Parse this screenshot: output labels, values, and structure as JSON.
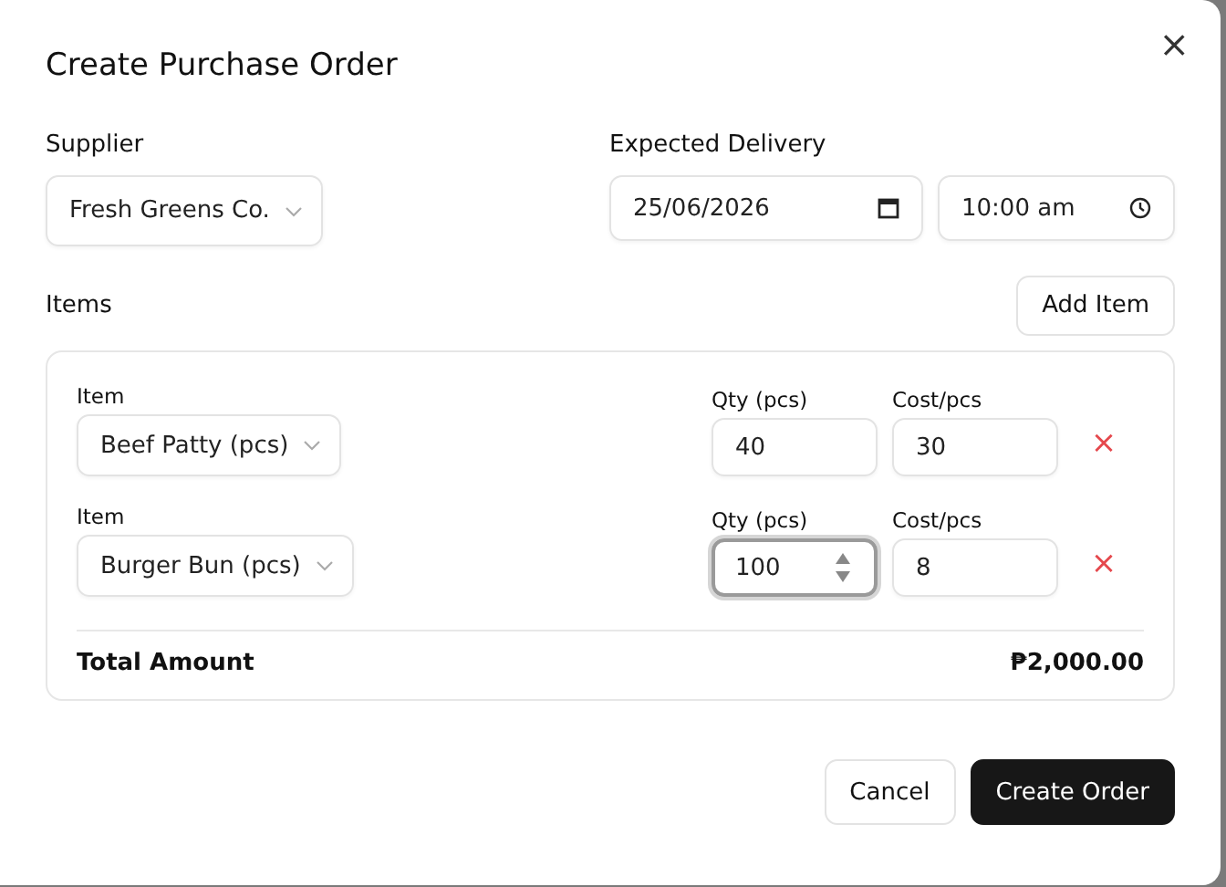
{
  "dialog": {
    "title": "Create Purchase Order",
    "close": "×"
  },
  "supplier": {
    "label": "Supplier",
    "value": "Fresh Greens Co."
  },
  "delivery": {
    "label": "Expected Delivery",
    "date": "25/06/2026",
    "time": "10:00 am"
  },
  "items_section": {
    "label": "Items",
    "add_button": "Add Item"
  },
  "items": [
    {
      "item_label": "Item",
      "item": "Beef Patty (pcs)",
      "qty_label": "Qty (pcs)",
      "qty": "40",
      "qty_focused": false,
      "cost_label": "Cost/pcs",
      "cost": "30",
      "remove": "×"
    },
    {
      "item_label": "Item",
      "item": "Burger Bun (pcs)",
      "qty_label": "Qty (pcs)",
      "qty": "100",
      "qty_focused": true,
      "cost_label": "Cost/pcs",
      "cost": "8",
      "remove": "×"
    }
  ],
  "total": {
    "label": "Total Amount",
    "value": "₱2,000.00"
  },
  "buttons": {
    "cancel": "Cancel",
    "submit": "Create Order"
  }
}
